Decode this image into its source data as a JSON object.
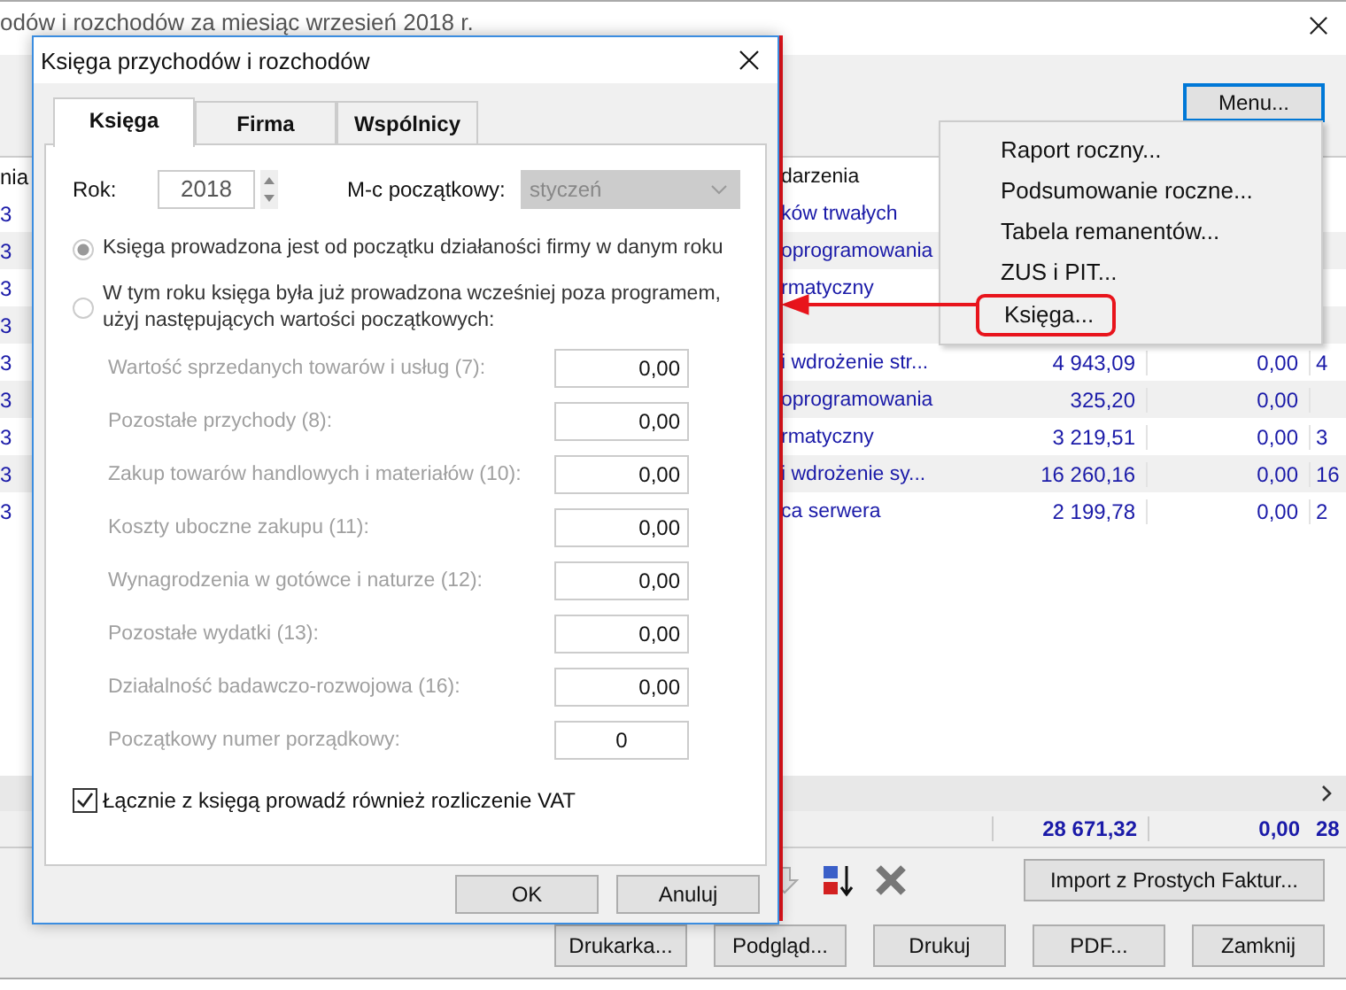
{
  "main_window": {
    "title": "odów i rozchodów za miesiąc wrzesień 2018 r.",
    "menu_button": "Menu...",
    "table": {
      "header": {
        "column_1": "nia",
        "description": "darzenia"
      },
      "rows": [
        {
          "column_1": "3",
          "description": "ków trwałych",
          "amount": "",
          "column_4": "",
          "column_5": ""
        },
        {
          "column_1": "3",
          "description": "oprogramowania",
          "amount": "",
          "column_4": "",
          "column_5": ""
        },
        {
          "column_1": "3",
          "description": "rmatyczny",
          "amount": "",
          "column_4": "",
          "column_5": ""
        },
        {
          "column_1": "3",
          "description": "",
          "amount": "",
          "column_4": "",
          "column_5": ""
        },
        {
          "column_1": "3",
          "description": "i wdrożenie str...",
          "amount": "4 943,09",
          "column_4": "0,00",
          "column_5": "4"
        },
        {
          "column_1": "3",
          "description": "oprogramowania",
          "amount": "325,20",
          "column_4": "0,00",
          "column_5": ""
        },
        {
          "column_1": "3",
          "description": "rmatyczny",
          "amount": "3 219,51",
          "column_4": "0,00",
          "column_5": "3"
        },
        {
          "column_1": "3",
          "description": "i wdrożenie sy...",
          "amount": "16 260,16",
          "column_4": "0,00",
          "column_5": "16"
        },
        {
          "column_1": "3",
          "description": "ca serwera",
          "amount": "2 199,78",
          "column_4": "0,00",
          "column_5": "2"
        }
      ],
      "totals": {
        "amount": "28 671,32",
        "column_4": "0,00",
        "column_5": "28"
      }
    },
    "toolbar": {
      "import_button": "Import z Prostych Faktur..."
    },
    "buttons": [
      "Drukarka...",
      "Podgląd...",
      "Drukuj",
      "PDF...",
      "Zamknij"
    ]
  },
  "menu": {
    "items": [
      {
        "label": "Raport roczny...",
        "annotated": false
      },
      {
        "label": "Podsumowanie roczne...",
        "annotated": false
      },
      {
        "label": "Tabela remanentów...",
        "annotated": false
      },
      {
        "label": "ZUS i PIT...",
        "annotated": false
      },
      {
        "label": "Księga...",
        "annotated": true
      }
    ]
  },
  "dialog": {
    "title": "Księga przychodów i rozchodów",
    "tabs": [
      {
        "label": "Księga",
        "selected": true
      },
      {
        "label": "Firma",
        "selected": false
      },
      {
        "label": "Wspólnicy",
        "selected": false
      }
    ],
    "year": {
      "label": "Rok:",
      "value": "2018"
    },
    "month": {
      "label": "M-c początkowy:",
      "value": "styczeń",
      "disabled": true
    },
    "options": [
      {
        "label": "Księga prowadzona jest od początku działaności firmy w danym roku",
        "selected": true,
        "disabled": true
      },
      {
        "label": "W tym roku księga była już prowadzona wcześniej poza programem, użyj następujących wartości początkowych:",
        "selected": false,
        "disabled": true
      }
    ],
    "starting_values": {
      "disabled": true,
      "fields": [
        {
          "label": "Wartość sprzedanych towarów i usług (7):",
          "value": "0,00",
          "kind": "amount"
        },
        {
          "label": "Pozostałe przychody (8):",
          "value": "0,00",
          "kind": "amount"
        },
        {
          "label": "Zakup towarów handlowych i materiałów (10):",
          "value": "0,00",
          "kind": "amount"
        },
        {
          "label": "Koszty uboczne zakupu (11):",
          "value": "0,00",
          "kind": "amount"
        },
        {
          "label": "Wynagrodzenia w gotówce i naturze (12):",
          "value": "0,00",
          "kind": "amount"
        },
        {
          "label": "Pozostałe wydatki (13):",
          "value": "0,00",
          "kind": "amount"
        },
        {
          "label": "Działalność badawczo-rozwojowa (16):",
          "value": "0,00",
          "kind": "amount"
        },
        {
          "label": "Początkowy numer porządkowy:",
          "value": "0",
          "kind": "counter"
        }
      ]
    },
    "vat": {
      "label": "Łącznie z księgą prowadź również rozliczenie VAT",
      "checked": true
    },
    "buttons": [
      "OK",
      "Anuluj"
    ]
  }
}
